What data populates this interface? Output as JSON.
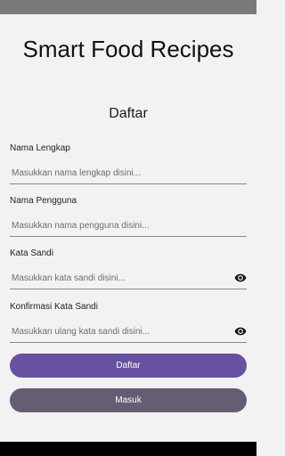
{
  "app": {
    "title": "Smart Food Recipes"
  },
  "form": {
    "title": "Daftar",
    "fields": [
      {
        "label": "Nama Lengkap",
        "placeholder": "Masukkan nama lengkap disini...",
        "value": ""
      },
      {
        "label": "Nama Pengguna",
        "placeholder": "Masukkan nama pengguna disini...",
        "value": ""
      },
      {
        "label": "Kata Sandi",
        "placeholder": "Masukkan kata sandi disini...",
        "value": "",
        "icon": "eye-icon"
      },
      {
        "label": "Konfirmasi Kata Sandi",
        "placeholder": "Masukkan ulang kata sandi disini...",
        "value": "",
        "icon": "eye-icon"
      }
    ]
  },
  "buttons": {
    "primary_label": "Daftar",
    "secondary_label": "Masuk"
  },
  "colors": {
    "background": "#f2f2f2",
    "primary_button": "#6851a0",
    "secondary_button": "#665d72",
    "status_bar": "#7a7a7a",
    "nav_bar": "#000000"
  }
}
